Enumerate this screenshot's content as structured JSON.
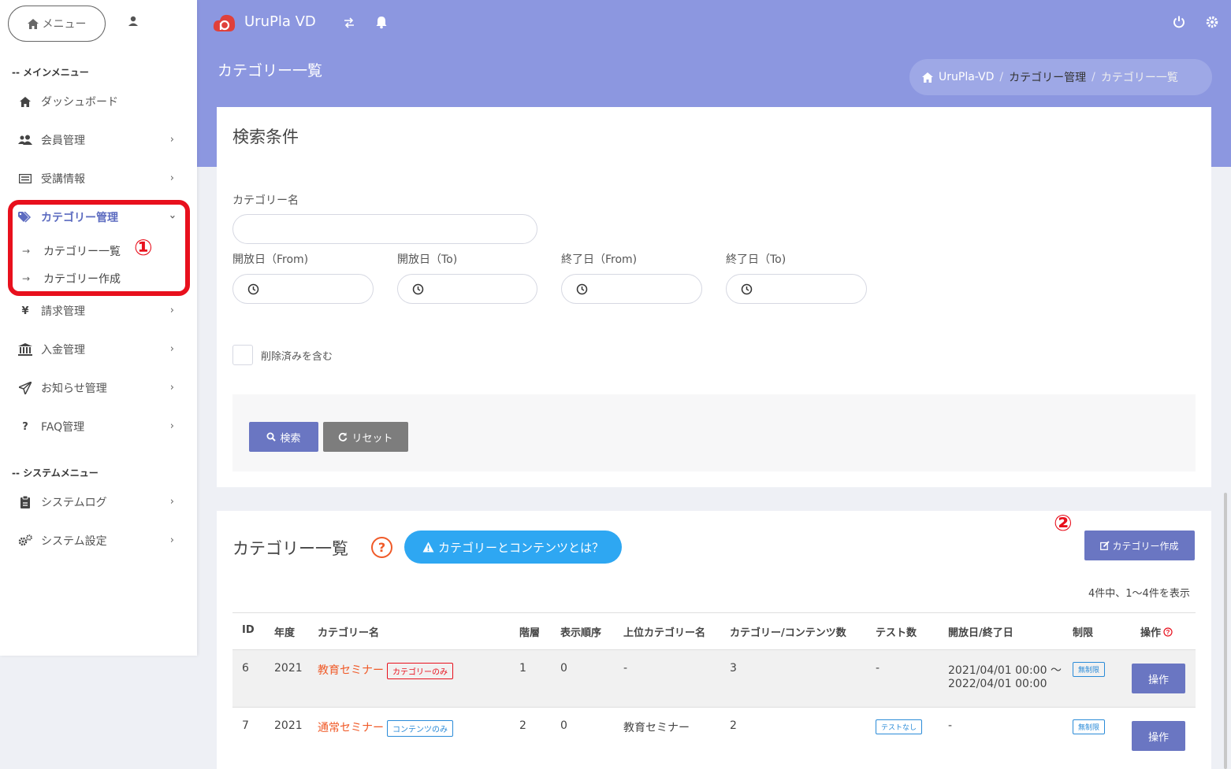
{
  "sidebar": {
    "menu_button": "メニュー",
    "main_menu_title": "-- メインメニュー",
    "system_menu_title": "-- システムメニュー",
    "items": [
      {
        "label": "ダッシュボード"
      },
      {
        "label": "会員管理"
      },
      {
        "label": "受講情報"
      },
      {
        "label": "カテゴリー管理"
      },
      {
        "label": "請求管理"
      },
      {
        "label": "入金管理"
      },
      {
        "label": "お知らせ管理"
      },
      {
        "label": "FAQ管理"
      }
    ],
    "sub_items": [
      {
        "label": "カテゴリー一覧"
      },
      {
        "label": "カテゴリー作成"
      }
    ],
    "system_items": [
      {
        "label": "システムログ"
      },
      {
        "label": "システム設定"
      }
    ],
    "yen_symbol": "¥",
    "question_symbol": "?",
    "annotation_1": "①"
  },
  "header": {
    "app_title": "UruPla VD",
    "page_title": "カテゴリー一覧",
    "breadcrumb": [
      "UruPla-VD",
      "カテゴリー管理",
      "カテゴリー一覧"
    ],
    "breadcrumb_sep": "/"
  },
  "search": {
    "title": "検索条件",
    "category_name_label": "カテゴリー名",
    "date_fields": [
      {
        "label": "開放日（From)"
      },
      {
        "label": "開放日（To)"
      },
      {
        "label": "終了日（From)"
      },
      {
        "label": "終了日（To)"
      }
    ],
    "include_deleted_label": "削除済みを含む",
    "search_button": "検索",
    "reset_button": "リセット"
  },
  "list": {
    "title": "カテゴリー一覧",
    "help_symbol": "?",
    "info_button": "カテゴリーとコンテンツとは？",
    "create_button": "カテゴリー作成",
    "annotation_2": "②",
    "count_text": "4件中、1〜4件を表示",
    "columns": [
      "ID",
      "年度",
      "カテゴリー名",
      "階層",
      "表示順序",
      "上位カテゴリー名",
      "カテゴリー/コンテンツ数",
      "テスト数",
      "開放日/終了日",
      "制限",
      "操作"
    ],
    "rows": [
      {
        "id": "6",
        "year": "2021",
        "name": "教育セミナー",
        "tag": "カテゴリーのみ",
        "level": "1",
        "order": "0",
        "parent": "-",
        "count": "3",
        "tests": "-",
        "date_from": "2021/04/01 00:00 ～",
        "date_to": "2022/04/01 00:00",
        "limit": "無制限",
        "action": "操作"
      },
      {
        "id": "7",
        "year": "2021",
        "name": "通常セミナー",
        "tag": "コンテンツのみ",
        "level": "2",
        "order": "0",
        "parent": "教育セミナー",
        "count": "2",
        "tests": "テストなし",
        "date": "-",
        "limit": "無制限",
        "action": "操作"
      }
    ]
  },
  "colors": {
    "accent": "#8c97e0",
    "button": "#6a76c2",
    "info": "#2ea7f2",
    "link": "#f05a28",
    "highlight": "#e8101d"
  }
}
